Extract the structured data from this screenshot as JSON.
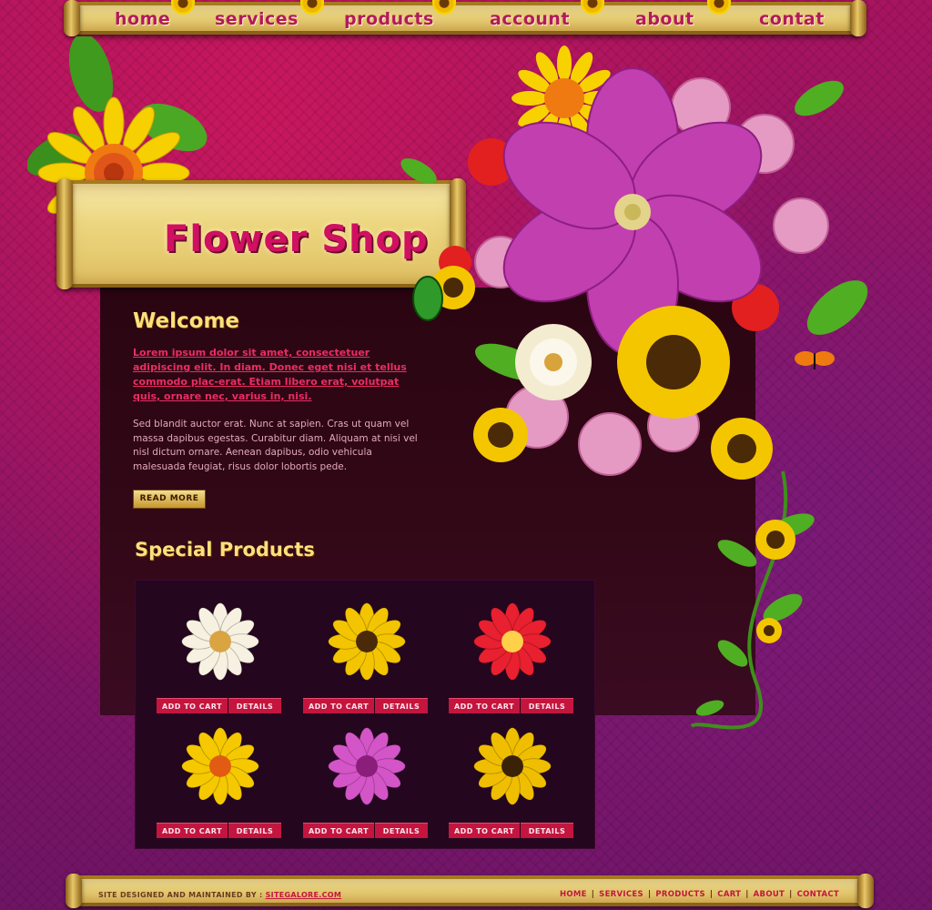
{
  "nav": {
    "home": "home",
    "services": "services",
    "products": "products",
    "account": "account",
    "about": "about",
    "contact": "contat"
  },
  "header": {
    "shop_title": "Flower Shop"
  },
  "welcome": {
    "heading": "Welcome",
    "lead": "Lorem ipsum dolor sit amet, consectetuer adipiscing elit. In diam. Donec eget nisi et tellus commodo plac-erat. Etiam libero erat, volutpat quis, ornare nec, varius in, nisi.",
    "body": "Sed blandit auctor erat. Nunc at sapien. Cras ut quam vel massa dapibus egestas. Curabitur diam. Aliquam at nisi vel nisl dictum ornare. Aenean dapibus, odio vehicula malesuada feugiat, risus dolor lobortis pede.",
    "read_more": "READ MORE"
  },
  "special": {
    "heading": "Special Products",
    "add_to_cart": "ADD TO CART",
    "details": "DETAILS",
    "products": [
      {
        "flower": "white-dahlia-icon",
        "petal": "#f7f1e1",
        "center": "#d9a441"
      },
      {
        "flower": "sunflower-icon",
        "petal": "#f3c400",
        "center": "#4a2a08"
      },
      {
        "flower": "red-hibiscus-icon",
        "petal": "#e8202f",
        "center": "#ffd14a"
      },
      {
        "flower": "orange-gerbera-icon",
        "petal": "#f5c800",
        "center": "#e25b12"
      },
      {
        "flower": "pink-dahlia-icon",
        "petal": "#d455c8",
        "center": "#8a1e7a"
      },
      {
        "flower": "sunflower-icon",
        "petal": "#f0be00",
        "center": "#3b2206"
      }
    ]
  },
  "footer": {
    "credit_label": "SITE DESIGNED AND MAINTAINED BY :",
    "credit_link": "SITEGALORE.COM",
    "links": [
      "HOME",
      "SERVICES",
      "PRODUCTS",
      "CART",
      "ABOUT",
      "CONTACT"
    ]
  },
  "colors": {
    "accent": "#c4153f",
    "heading_gold": "#f9e27a",
    "title_pink": "#d01060"
  }
}
